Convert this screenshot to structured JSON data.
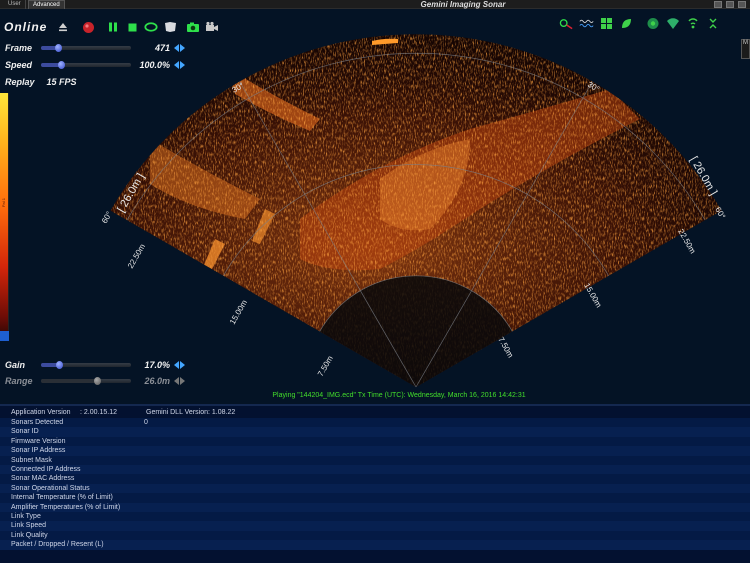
{
  "titlebar": {
    "tabs": [
      "User",
      "Advanced"
    ],
    "title": "Gemini Imaging Sonar"
  },
  "toolbar": {
    "status": "Online",
    "icons": [
      "eject-icon",
      "record-icon",
      "pause-icon",
      "stop-icon",
      "loop-icon",
      "bookmark-icon",
      "camera-icon",
      "video-camera-icon"
    ]
  },
  "right_toolbar": {
    "icons": [
      "measure-icon",
      "waveform-icon",
      "palette-icon",
      "leaf-icon",
      "compass-icon",
      "sonar-head-icon",
      "signal-icon",
      "zoom-controls-icon"
    ],
    "side_label": "M"
  },
  "sliders": {
    "frame": {
      "label": "Frame",
      "value": "471",
      "level": 0.18
    },
    "speed": {
      "label": "Speed",
      "value": "100.0%",
      "level": 0.22
    },
    "gain": {
      "label": "Gain",
      "value": "17.0%",
      "level": 0.17
    },
    "range": {
      "label": "Range",
      "value": "26.0m",
      "level": 0.62
    }
  },
  "replay": {
    "label": "Replay",
    "fps": "15 FPS"
  },
  "colorbar": {
    "label": "Pal 1"
  },
  "sonar": {
    "range_labels": [
      "7.50m",
      "15.00m",
      "22.50m",
      "[ 26.0m ]"
    ],
    "angle_labels": [
      "60°",
      "30°",
      "30°",
      "60°"
    ]
  },
  "playing": "Playing \"144204_IMG.ecd\" Tx Time (UTC): Wednesday, March 16, 2016 14:42:31",
  "info": {
    "app_version_label": "Application Version",
    "app_version": ": 2.00.15.12",
    "gemini_dll_label": "Gemini DLL Version",
    "gemini_dll": ": 1.08.22",
    "rows": [
      {
        "label": "Sonars Detected",
        "value": "0"
      },
      {
        "label": "Sonar ID",
        "value": ""
      },
      {
        "label": "Firmware Version",
        "value": ""
      },
      {
        "label": "Sonar IP Address",
        "value": ""
      },
      {
        "label": "Subnet Mask",
        "value": ""
      },
      {
        "label": "Connected IP Address",
        "value": ""
      },
      {
        "label": "Sonar MAC Address",
        "value": ""
      },
      {
        "label": "Sonar Operational Status",
        "value": ""
      },
      {
        "label": "Internal Temperature (% of Limit)",
        "value": ""
      },
      {
        "label": "Amplifier Temperatures (% of Limit)",
        "value": ""
      },
      {
        "label": "Link Type",
        "value": ""
      },
      {
        "label": "Link Speed",
        "value": ""
      },
      {
        "label": "Link Quality",
        "value": ""
      },
      {
        "label": "Packet / Dropped / Resent (L)",
        "value": ""
      }
    ]
  },
  "colors": {
    "background": "#041325",
    "accent_green": "#43df2b",
    "slider_blue": "#3448c9"
  }
}
